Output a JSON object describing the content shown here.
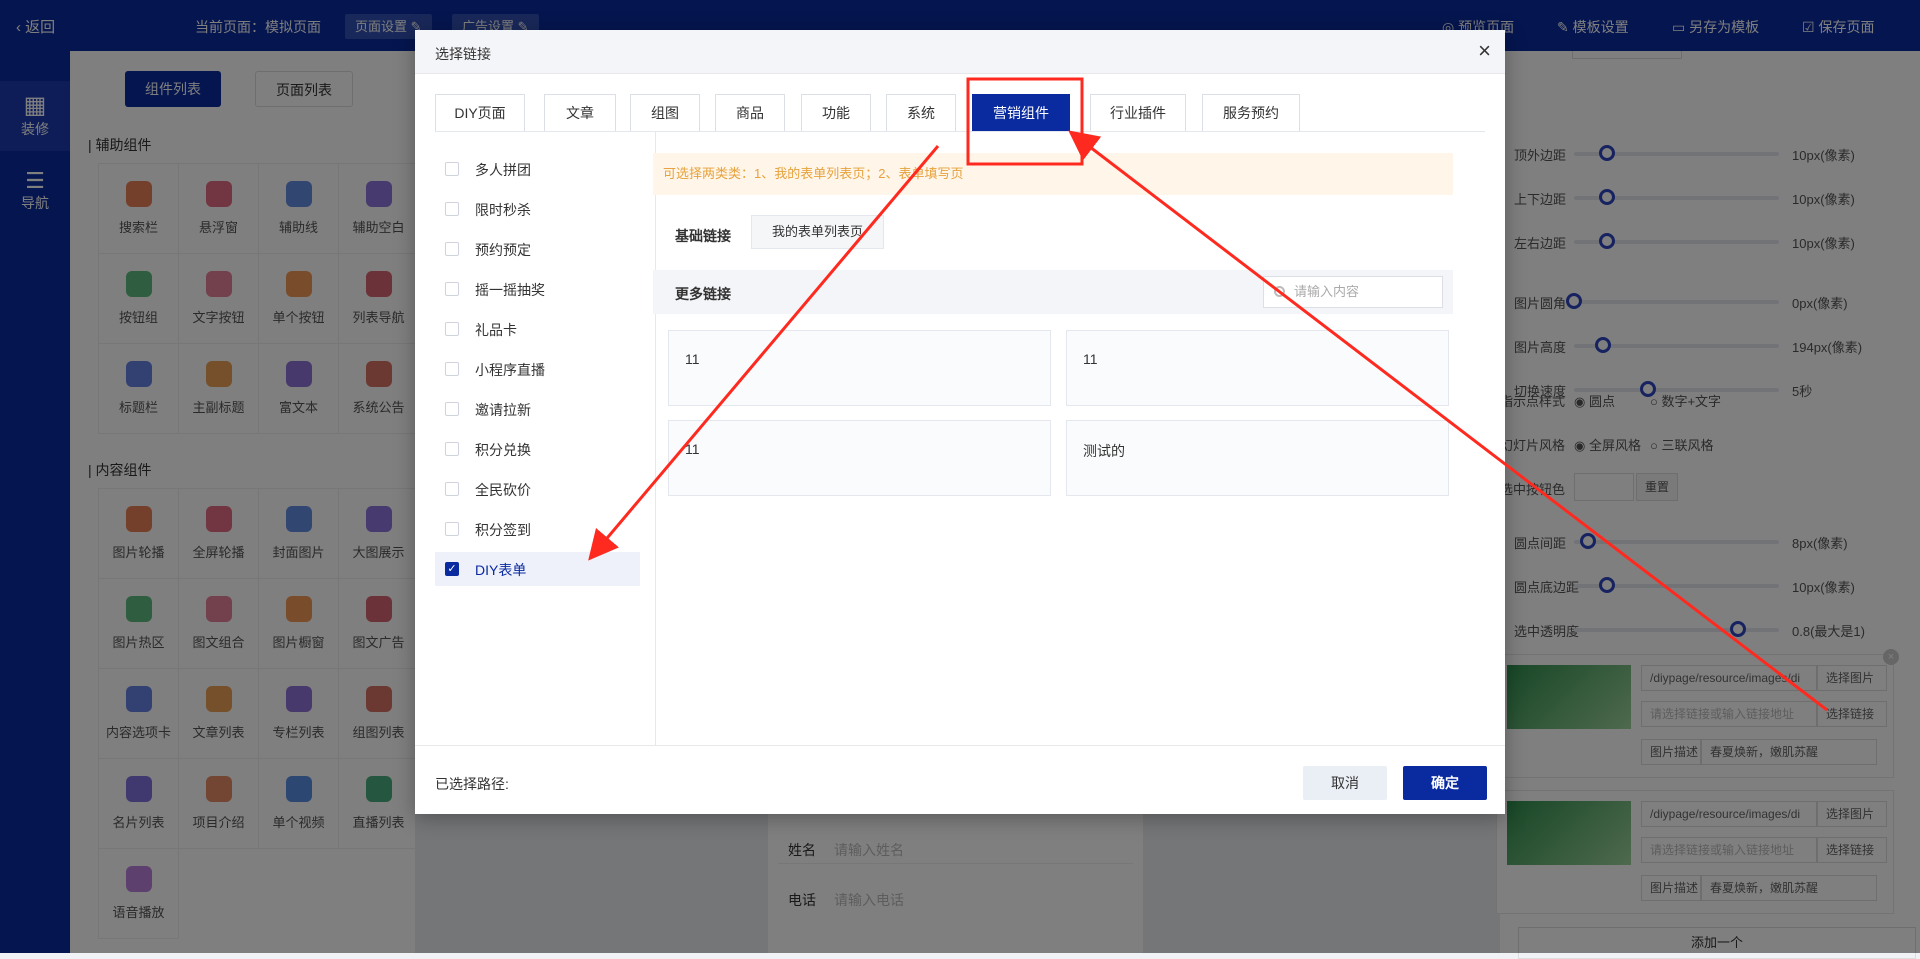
{
  "topbar": {
    "back": "返回",
    "current_page": "当前页面：模拟页面",
    "page_settings": "页面设置",
    "ad_settings": "广告设置",
    "preview": "预览页面",
    "template_settings": "模板设置",
    "save_as_template": "另存为模板",
    "save_page": "保存页面"
  },
  "leftnav": {
    "decorate": "装修",
    "nav": "导航"
  },
  "panel_left": {
    "tab_components": "组件列表",
    "tab_pages": "页面列表",
    "group_aux": "辅助组件",
    "aux_items": [
      "搜索栏",
      "悬浮窗",
      "辅助线",
      "辅助空白",
      "按钮组",
      "文字按钮",
      "单个按钮",
      "列表导航",
      "标题栏",
      "主副标题",
      "富文本",
      "系统公告"
    ],
    "group_content": "内容组件",
    "content_items": [
      "图片轮播",
      "全屏轮播",
      "封面图片",
      "大图展示",
      "图片热区",
      "图文组合",
      "图片橱窗",
      "图文广告",
      "内容选项卡",
      "文章列表",
      "专栏列表",
      "组图列表",
      "名片列表",
      "项目介绍",
      "单个视频",
      "直播列表",
      "语音播放"
    ]
  },
  "rightpanel": {
    "rows": [
      {
        "label": "顶外边距",
        "value": "10px(像素)",
        "level": 0.16
      },
      {
        "label": "上下边距",
        "value": "10px(像素)",
        "level": 0.16
      },
      {
        "label": "左右边距",
        "value": "10px(像素)",
        "level": 0.16
      },
      {
        "label": "图片圆角",
        "value": "0px(像素)",
        "level": 0.0
      },
      {
        "label": "图片高度",
        "value": "194px(像素)",
        "level": 0.14
      },
      {
        "label": "切换速度",
        "value": "5秒",
        "level": 0.36
      },
      {
        "label": "圆点间距",
        "value": "8px(像素)",
        "level": 0.07
      },
      {
        "label": "圆点底边距",
        "value": "10px(像素)",
        "level": 0.16
      },
      {
        "label": "选中透明度",
        "value": "0.8(最大是1)",
        "level": 0.8
      }
    ],
    "indicator_label": "指示点样式",
    "indicator_opt1": "圆点",
    "indicator_opt2": "数字+文字",
    "slide_label": "幻灯片风格",
    "slide_opt1": "全屏风格",
    "slide_opt2": "三联风格",
    "selected_color_label": "选中按钮色",
    "reset": "重置",
    "cards": [
      {
        "path": "/diypage/resource/images/di",
        "choose_img": "选择图片",
        "link_placeholder": "请选择链接或输入链接地址",
        "choose_link": "选择链接",
        "desc_label": "图片描述",
        "desc": "春夏焕新，嫩肌苏醒"
      },
      {
        "path": "/diypage/resource/images/di",
        "choose_img": "选择图片",
        "link_placeholder": "请选择链接或输入链接地址",
        "choose_link": "选择链接",
        "desc_label": "图片描述",
        "desc": "春夏焕新，嫩肌苏醒"
      }
    ],
    "add_one": "添加一个"
  },
  "phone": {
    "name_label": "姓名",
    "name_placeholder": "请输入姓名",
    "phone_label": "电话",
    "phone_placeholder": "请输入电话"
  },
  "modal": {
    "title": "选择链接",
    "tabs": [
      "DIY页面",
      "文章",
      "组图",
      "商品",
      "功能",
      "系统",
      "营销组件",
      "行业插件",
      "服务预约"
    ],
    "active_tab": "营销组件",
    "categories": [
      "多人拼团",
      "限时秒杀",
      "预约预定",
      "摇一摇抽奖",
      "礼品卡",
      "小程序直播",
      "邀请拉新",
      "积分兑换",
      "全民砍价",
      "积分签到",
      "DIY表单"
    ],
    "active_category": "DIY表单",
    "notice": "可选择两类类：1、我的表单列表页；2、表单填写页",
    "basic_label": "基础链接",
    "basic_link": "我的表单列表页",
    "more_label": "更多链接",
    "search_placeholder": "请输入内容",
    "links": [
      "11",
      "11",
      "11",
      "测试的"
    ],
    "path_label": "已选择路径:",
    "cancel": "取消",
    "ok": "确定"
  },
  "colors": {
    "primary": "#0a2aa0",
    "annotation": "#ff2a1f"
  }
}
